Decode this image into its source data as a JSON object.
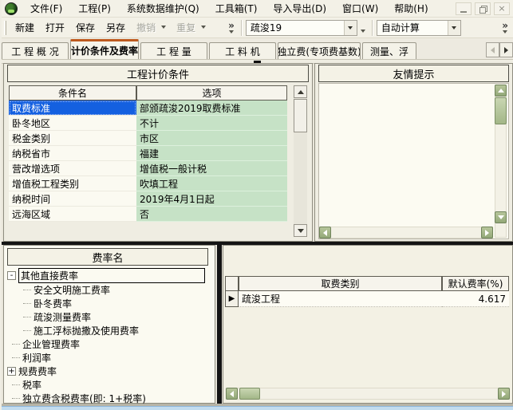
{
  "menu": {
    "items": [
      {
        "label": "文件(F)"
      },
      {
        "label": "工程(P)"
      },
      {
        "label": "系统数据维护(Q)"
      },
      {
        "label": "工具箱(T)"
      },
      {
        "label": "导入导出(D)"
      },
      {
        "label": "窗口(W)"
      },
      {
        "label": "帮助(H)"
      }
    ]
  },
  "window_controls": {
    "close_glyph": "×"
  },
  "toolbar": {
    "buttons": {
      "new": "新建",
      "open": "打开",
      "save": "保存",
      "save_as": "另存",
      "undo": "撤销",
      "redo": "重复"
    },
    "overflow_glyph": "»",
    "template_combo_value": "疏浚19",
    "calc_combo_value": "自动计算"
  },
  "tabs": [
    {
      "label": "工 程 概 况"
    },
    {
      "label": "计价条件及费率"
    },
    {
      "label": "工  程  量"
    },
    {
      "label": "工  料  机"
    },
    {
      "label": "独立费(专项费基数)"
    },
    {
      "label": "测量、浮"
    }
  ],
  "pricing_panel": {
    "title": "工程计价条件",
    "columns": {
      "name": "条件名",
      "option": "选项"
    },
    "rows": [
      {
        "name": "取费标准",
        "value": "部颁疏浚2019取费标准"
      },
      {
        "name": "卧冬地区",
        "value": "不计"
      },
      {
        "name": "税金类别",
        "value": "市区"
      },
      {
        "name": "纳税省市",
        "value": "福建"
      },
      {
        "name": "营改增选项",
        "value": "增值税一般计税"
      },
      {
        "name": "增值税工程类别",
        "value": "吹填工程"
      },
      {
        "name": "纳税时间",
        "value": "2019年4月1日起"
      },
      {
        "name": "远海区域",
        "value": "否"
      }
    ]
  },
  "tips_panel": {
    "title": "友情提示",
    "content": ""
  },
  "rate_tree": {
    "title": "费率名",
    "items": [
      {
        "label": "其他直接费率",
        "expander": "-"
      },
      {
        "label": "安全文明施工费率"
      },
      {
        "label": "卧冬费率"
      },
      {
        "label": "疏浚测量费率"
      },
      {
        "label": "施工浮标抛撒及使用费率"
      },
      {
        "label": "企业管理费率"
      },
      {
        "label": "利润率"
      },
      {
        "label": "规费费率",
        "expander": "+"
      },
      {
        "label": "税率"
      },
      {
        "label": "独立费含税费率(即: 1+税率)"
      }
    ]
  },
  "rate_table": {
    "columns": {
      "category": "取费类别",
      "rate": "默认费率(%)"
    },
    "rows": [
      {
        "marker": "▶",
        "category": "疏浚工程",
        "rate": "4.617"
      }
    ]
  }
}
